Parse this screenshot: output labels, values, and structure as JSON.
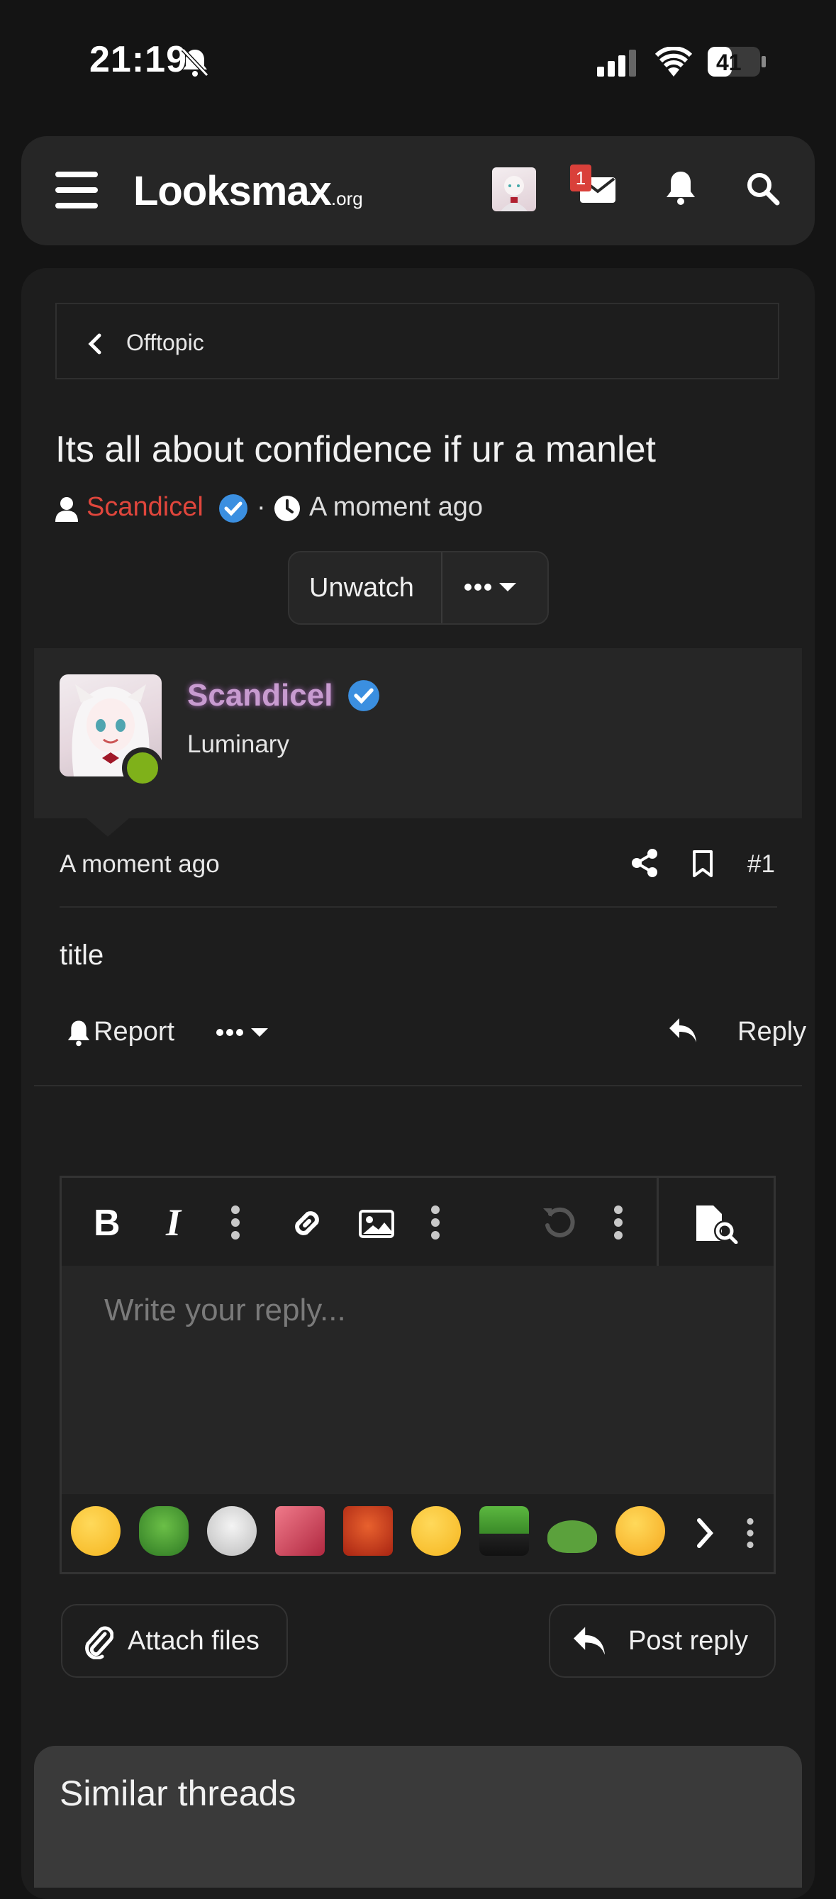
{
  "status_bar": {
    "time": "21:19",
    "battery": "41"
  },
  "header": {
    "logo_main": "Looksmax",
    "logo_suffix": ".org",
    "inbox_badge": "1"
  },
  "breadcrumb": {
    "label": "Offtopic"
  },
  "thread": {
    "title": "Its all about confidence if ur a manlet",
    "author": "Scandicel",
    "separator": "·",
    "time": "A moment ago",
    "unwatch_label": "Unwatch"
  },
  "post": {
    "author": "Scandicel",
    "role": "Luminary",
    "time": "A moment ago",
    "number": "#1",
    "body": "title",
    "report_label": "Report",
    "reply_label": "Reply"
  },
  "editor": {
    "placeholder": "Write your reply...",
    "attach_label": "Attach files",
    "post_reply_label": "Post reply"
  },
  "smilies": [
    "thinking",
    "pepe-frog",
    "crying-wojak",
    "anime-face",
    "red-face",
    "grinning",
    "pepe-suit",
    "small-frog",
    "rofl"
  ],
  "similar": {
    "title": "Similar threads"
  },
  "colors": {
    "accent_red": "#e0463c",
    "verified_blue": "#3b8fe0",
    "online_green": "#7fb11a"
  }
}
